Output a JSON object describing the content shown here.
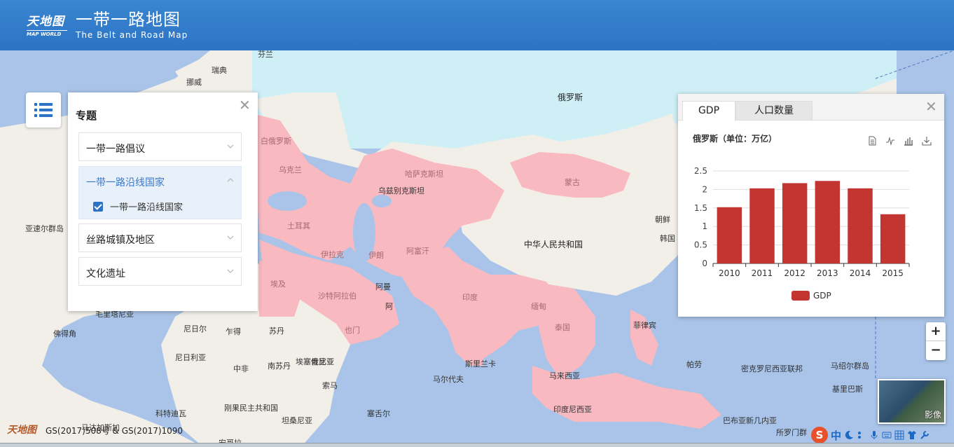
{
  "header": {
    "logo_cn": "天地图",
    "logo_en": "MAP WORLD",
    "title_cn": "一带一路地图",
    "title_en": "The Belt and Road Map"
  },
  "topic_panel": {
    "title": "专题",
    "items": [
      {
        "label": "一带一路倡议"
      },
      {
        "label": "一带一路沿线国家",
        "sub_label": "一带一路沿线国家"
      },
      {
        "label": "丝路城镇及地区"
      },
      {
        "label": "文化遗址"
      }
    ]
  },
  "chart_panel": {
    "tabs": [
      "GDP",
      "人口数量"
    ],
    "subtitle": "俄罗斯（单位：万亿）"
  },
  "chart_data": {
    "type": "bar",
    "categories": [
      "2010",
      "2011",
      "2012",
      "2013",
      "2014",
      "2015"
    ],
    "series": [
      {
        "name": "GDP",
        "values": [
          1.52,
          2.03,
          2.17,
          2.23,
          2.03,
          1.33
        ],
        "color": "#c23531"
      }
    ],
    "y_ticks": [
      "0",
      "0.5",
      "1",
      "1.5",
      "2",
      "2.5"
    ],
    "ylim": [
      0,
      2.5
    ],
    "legend": "bottom-center"
  },
  "map": {
    "labels": {
      "russia": "俄罗斯",
      "china": "中华人民共和国",
      "kazakhstan": "哈萨克斯坦",
      "mongolia": "蒙古",
      "ukraine": "乌克兰",
      "belarus": "白俄罗斯",
      "turkey": "土耳其",
      "iraq": "伊拉克",
      "iran": "伊朗",
      "afghanistan": "阿富汗",
      "saudi": "沙特阿拉伯",
      "india": "印度",
      "myanmar": "缅甸",
      "thailand": "泰国",
      "egypt": "埃及",
      "yemen": "也门",
      "oman_1": "阿曼",
      "oman_2": "阿",
      "korea_n": "朝鲜",
      "korea_s": "韩国",
      "philippines": "菲律宾",
      "palau": "帕劳",
      "micronesia": "密克罗尼西亚联邦",
      "marshall": "马绍尔群岛",
      "kiribati": "基里巴斯",
      "png": "巴布亚新几内亚",
      "solomon": "所罗门群",
      "sweden": "瑞典",
      "norway": "挪威",
      "finland_partial": "芬兰",
      "niger": "尼日尔",
      "chad": "乍得",
      "sudan": "苏丹",
      "nigeria": "尼日利亚",
      "ethiopia": "埃塞俄比亚",
      "south_sudan": "南苏丹",
      "central_africa": "中非",
      "drc": "刚果民主共和国",
      "tanzania": "坦桑尼亚",
      "angola": "安哥拉",
      "seychelles": "塞舌尔",
      "maldives": "马尔代夫",
      "srilanka": "斯里兰卡",
      "malaysia": "马来西亚",
      "indonesia": "印度尼西亚",
      "cape_verde": "佛得角",
      "west_africa": "科特迪瓦",
      "mauritania_partial": "毛里塔尼亚",
      "azores": "亚速尔群岛",
      "uzbekistan": "乌兹别克斯坦",
      "somalia": "索马",
      "kenya": "肯尼亚",
      "madagascar_partial": "马达加斯加"
    }
  },
  "zoom": {
    "in": "+",
    "out": "−"
  },
  "imagery": {
    "label": "影像"
  },
  "footer": {
    "logo": "天地图",
    "copyright": "GS(2017)508号 & GS(2017)1090"
  },
  "ime": {
    "mode": "中"
  }
}
